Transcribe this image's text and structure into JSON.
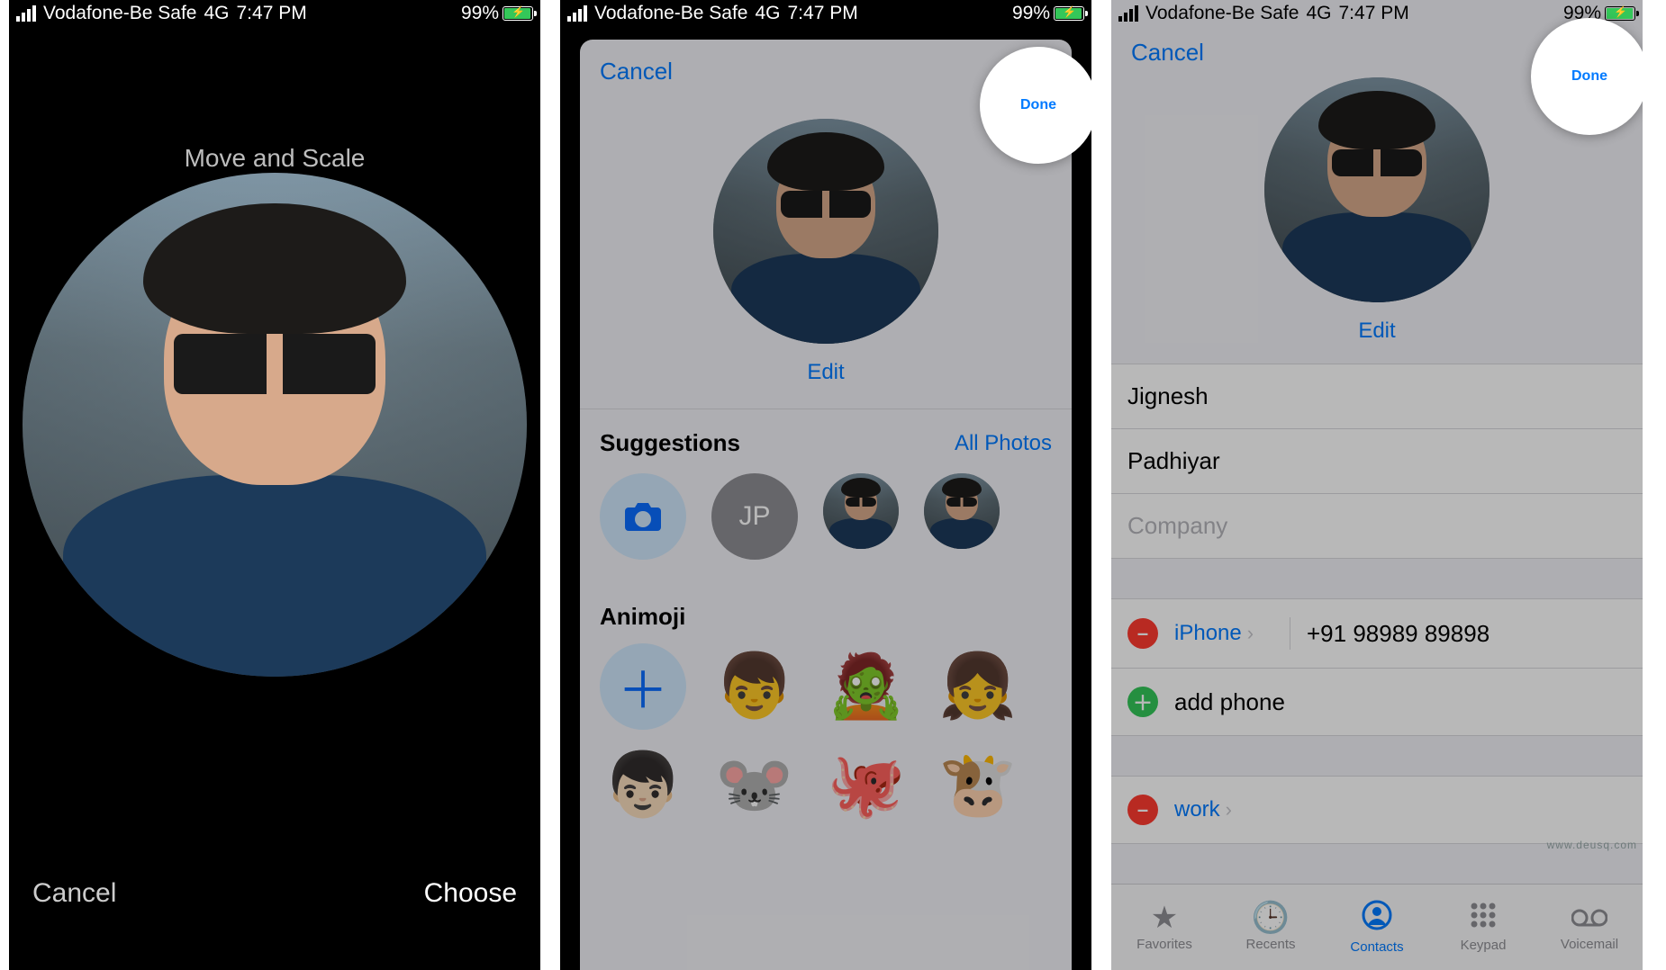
{
  "status": {
    "carrier": "Vodafone-Be Safe",
    "network": "4G",
    "time": "7:47 PM",
    "battery": "99%"
  },
  "screen1": {
    "title": "Move and Scale",
    "cancel": "Cancel",
    "choose": "Choose"
  },
  "screen2": {
    "cancel": "Cancel",
    "done": "Done",
    "edit": "Edit",
    "suggestions_title": "Suggestions",
    "all_photos": "All Photos",
    "initials": "JP",
    "animoji_title": "Animoji"
  },
  "screen3": {
    "cancel": "Cancel",
    "done": "Done",
    "edit": "Edit",
    "first_name": "Jignesh",
    "last_name": "Padhiyar",
    "company_placeholder": "Company",
    "phone_label": "iPhone",
    "phone_value": "+91 98989 89898",
    "add_phone": "add phone",
    "work_label": "work",
    "tabs": {
      "favorites": "Favorites",
      "recents": "Recents",
      "contacts": "Contacts",
      "keypad": "Keypad",
      "voicemail": "Voicemail"
    }
  },
  "watermark": "www.deusq.com"
}
